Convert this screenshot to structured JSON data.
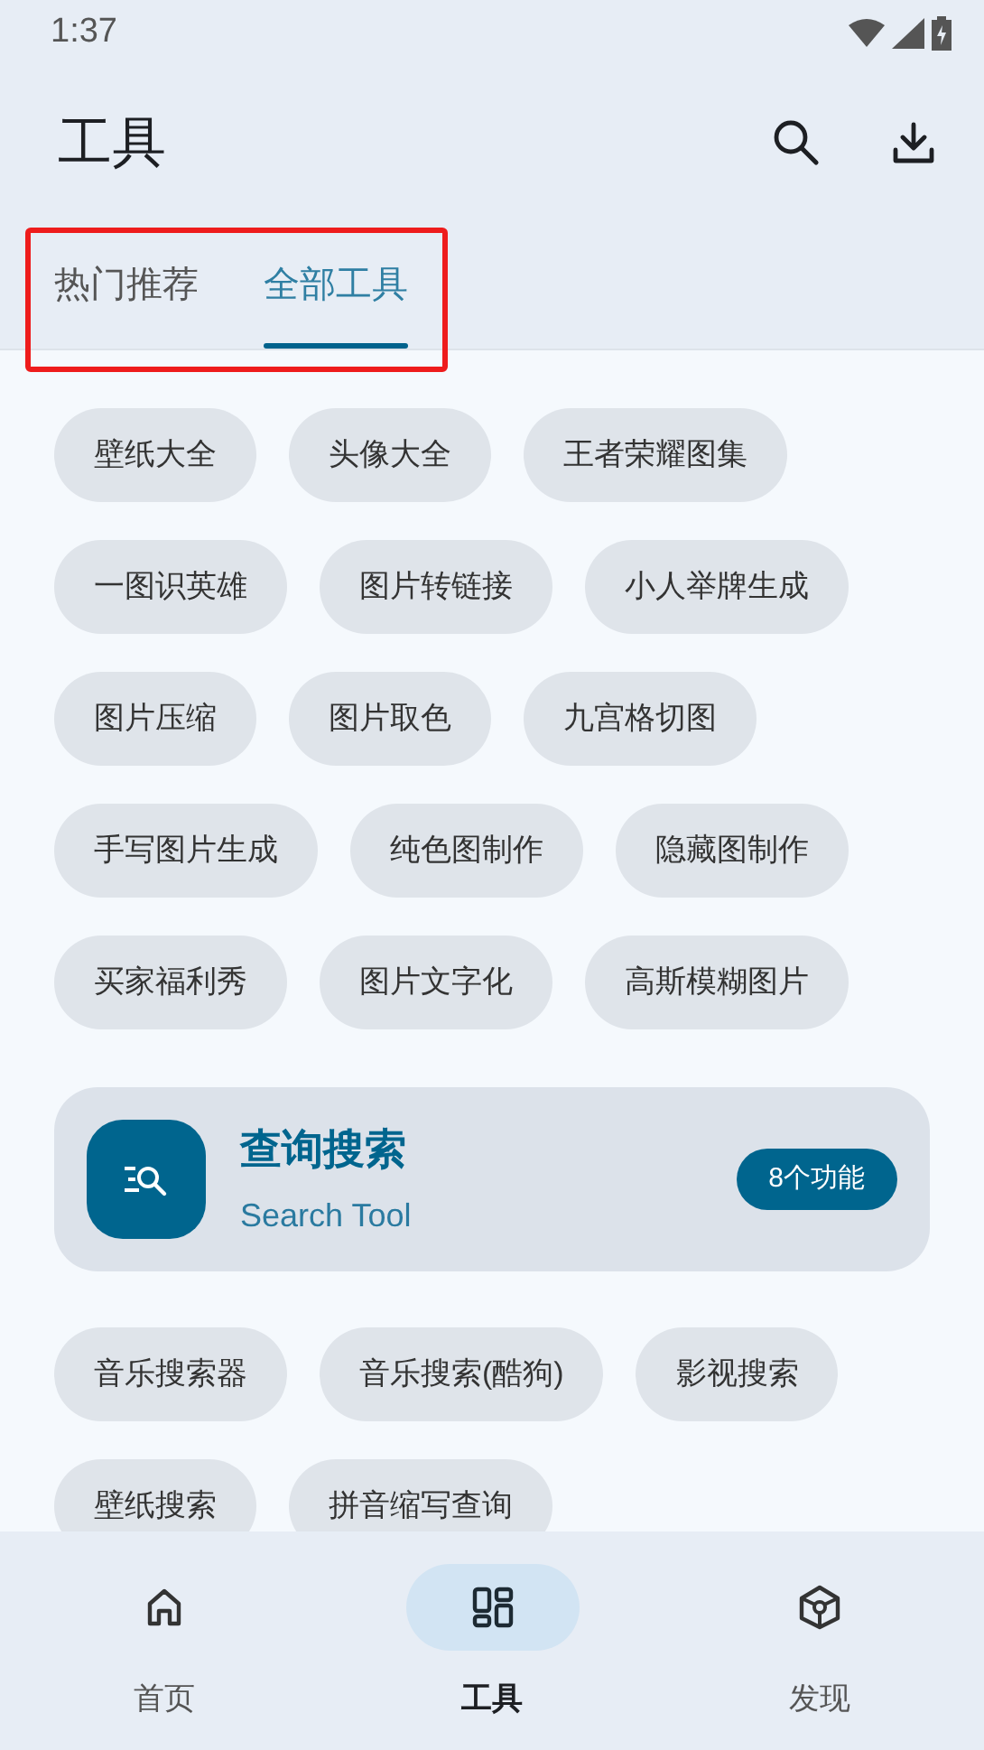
{
  "status_bar": {
    "time": "1:37"
  },
  "app_bar": {
    "title": "工具"
  },
  "tabs": [
    {
      "label": "热门推荐",
      "selected": false
    },
    {
      "label": "全部工具",
      "selected": true
    }
  ],
  "chips_1": [
    "壁纸大全",
    "头像大全",
    "王者荣耀图集",
    "一图识英雄",
    "图片转链接",
    "小人举牌生成",
    "图片压缩",
    "图片取色",
    "九宫格切图",
    "手写图片生成",
    "纯色图制作",
    "隐藏图制作",
    "买家福利秀",
    "图片文字化",
    "高斯模糊图片"
  ],
  "category": {
    "title": "查询搜索",
    "subtitle": "Search Tool",
    "count": "8个功能"
  },
  "chips_2": [
    "音乐搜索器",
    "音乐搜索(酷狗)",
    "影视搜索",
    "壁纸搜索",
    "拼音缩写查询"
  ],
  "bottom_nav": [
    {
      "label": "首页",
      "selected": false
    },
    {
      "label": "工具",
      "selected": true
    },
    {
      "label": "发现",
      "selected": false
    }
  ]
}
